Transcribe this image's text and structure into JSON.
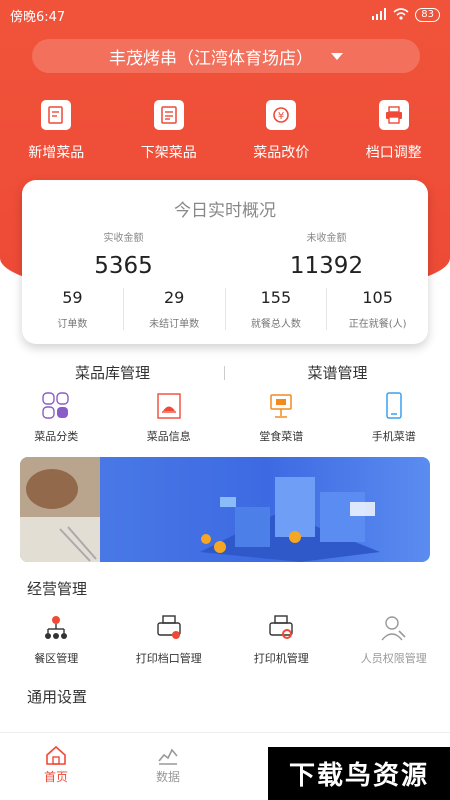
{
  "status_bar": {
    "time": "傍晚6:47",
    "battery": "83"
  },
  "store": {
    "name": "丰茂烤串（江湾体育场店）"
  },
  "quick_actions": [
    {
      "label": "新增菜品",
      "icon": "add-dish-icon"
    },
    {
      "label": "下架菜品",
      "icon": "remove-dish-icon"
    },
    {
      "label": "菜品改价",
      "icon": "price-change-icon"
    },
    {
      "label": "档口调整",
      "icon": "printer-icon"
    }
  ],
  "overview": {
    "title": "今日实时概况",
    "received_label": "实收金额",
    "received_value": "5365",
    "unreceived_label": "未收金额",
    "unreceived_value": "11392",
    "stats": [
      {
        "value": "59",
        "label": "订单数"
      },
      {
        "value": "29",
        "label": "未结订单数"
      },
      {
        "value": "155",
        "label": "就餐总人数"
      },
      {
        "value": "105",
        "label": "正在就餐(人)"
      }
    ]
  },
  "tabs": {
    "left": "菜品库管理",
    "right": "菜谱管理"
  },
  "dish_menu": [
    {
      "label": "菜品分类",
      "icon": "category-icon"
    },
    {
      "label": "菜品信息",
      "icon": "dish-cover-icon"
    },
    {
      "label": "堂食菜谱",
      "icon": "dine-in-menu-icon"
    },
    {
      "label": "手机菜谱",
      "icon": "mobile-menu-icon"
    }
  ],
  "operations": {
    "title": "经营管理",
    "items": [
      {
        "label": "餐区管理",
        "icon": "area-tree-icon"
      },
      {
        "label": "打印档口管理",
        "icon": "print-station-icon"
      },
      {
        "label": "打印机管理",
        "icon": "printer-manage-icon"
      },
      {
        "label": "人员权限管理",
        "icon": "user-permission-icon"
      }
    ]
  },
  "settings": {
    "title": "通用设置"
  },
  "tabbar": [
    {
      "label": "首页",
      "icon": "home-icon"
    },
    {
      "label": "数据",
      "icon": "chart-icon"
    }
  ],
  "watermark": "下载鸟资源",
  "colors": {
    "accent": "#ee4a36",
    "banner": "#3d6ae2"
  }
}
